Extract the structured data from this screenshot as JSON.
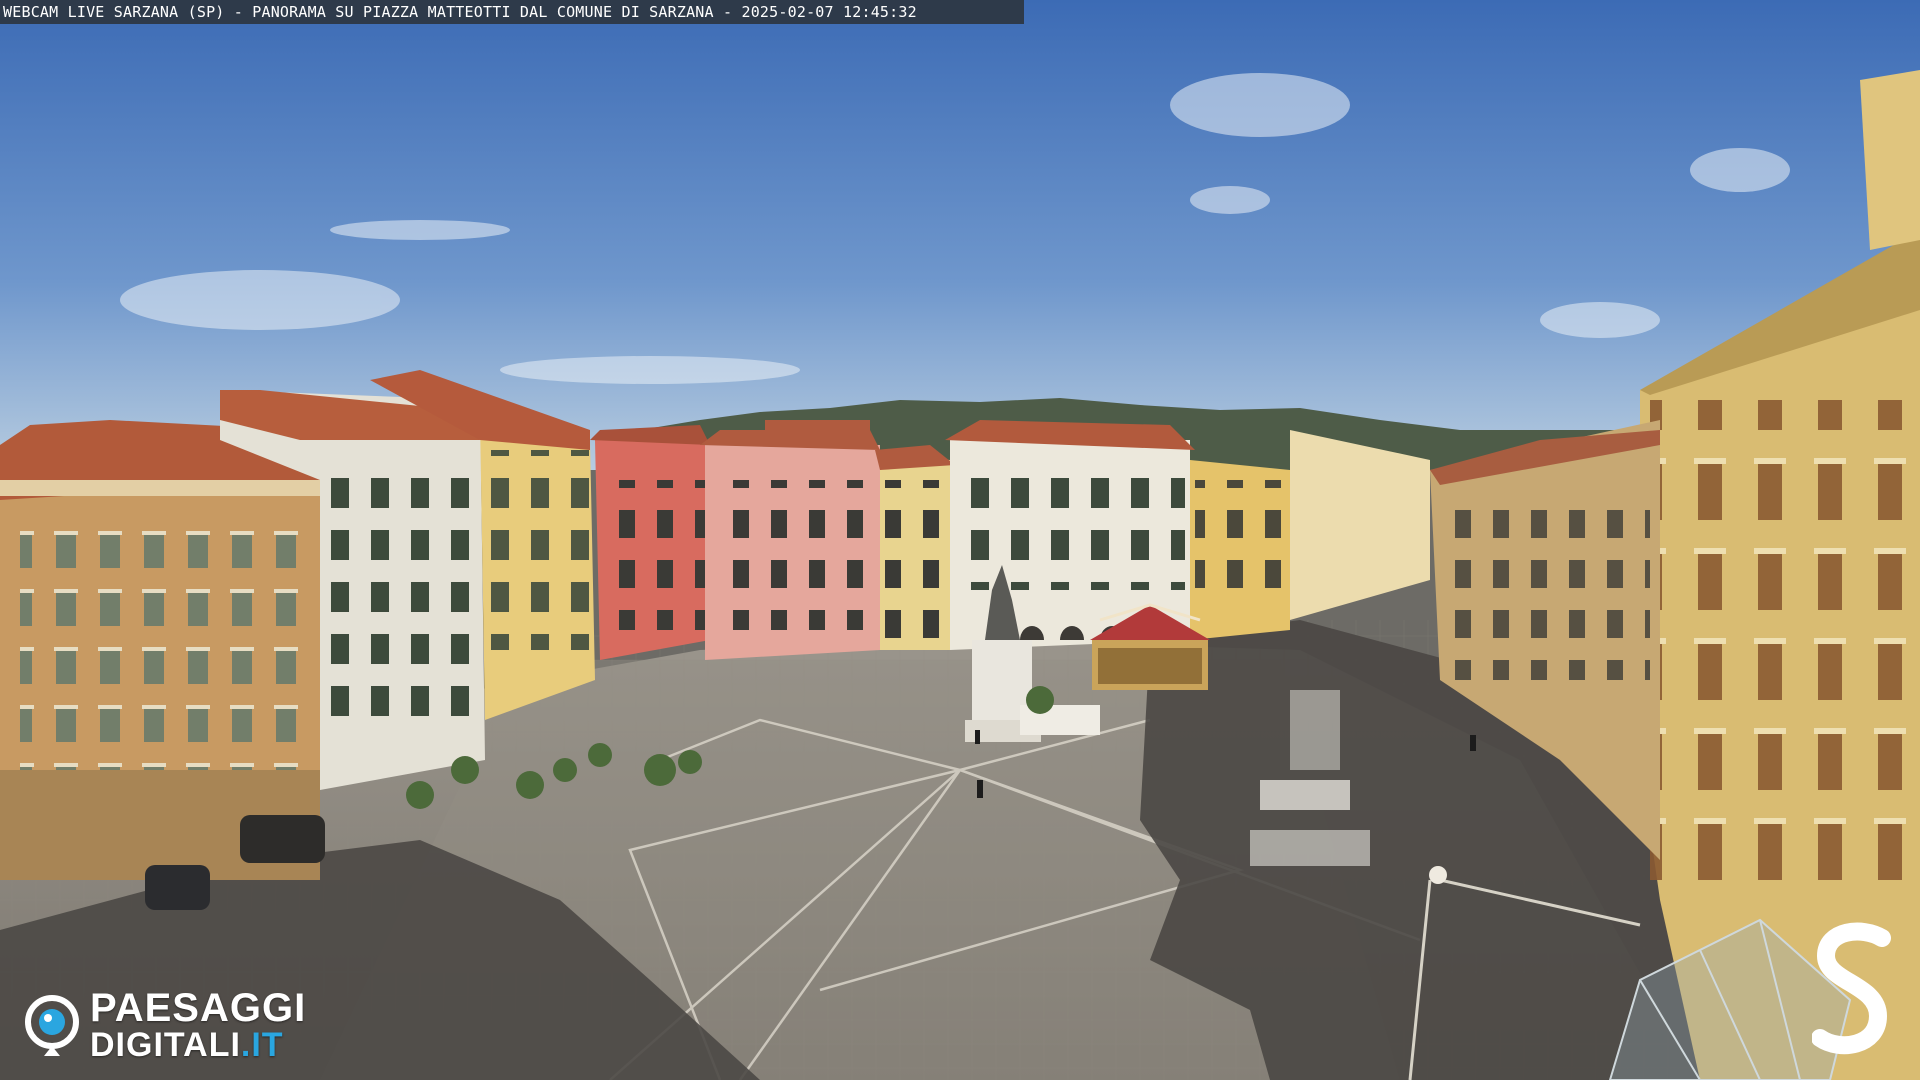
{
  "overlay": {
    "title": "WEBCAM LIVE SARZANA (SP) - PANORAMA SU PIAZZA MATTEOTTI DAL COMUNE DI SARZANA - 2025-02-07  12:45:32"
  },
  "branding": {
    "logo_line1": "PAESAGGI",
    "logo_line2_main": "DIGITALI",
    "logo_line2_suffix": ".IT",
    "logo_icon": "eye-camera-icon",
    "corner_logo": "s-mark-logo"
  },
  "colors": {
    "sky_top": "#3f6fb8",
    "sky_bottom": "#a9c3de",
    "plaza": "#8a857c",
    "shadow": "#4e4b47",
    "roof": "#b5573a",
    "brand_blue": "#2aa6e0",
    "overlay_bg": "#2e3a4a"
  }
}
